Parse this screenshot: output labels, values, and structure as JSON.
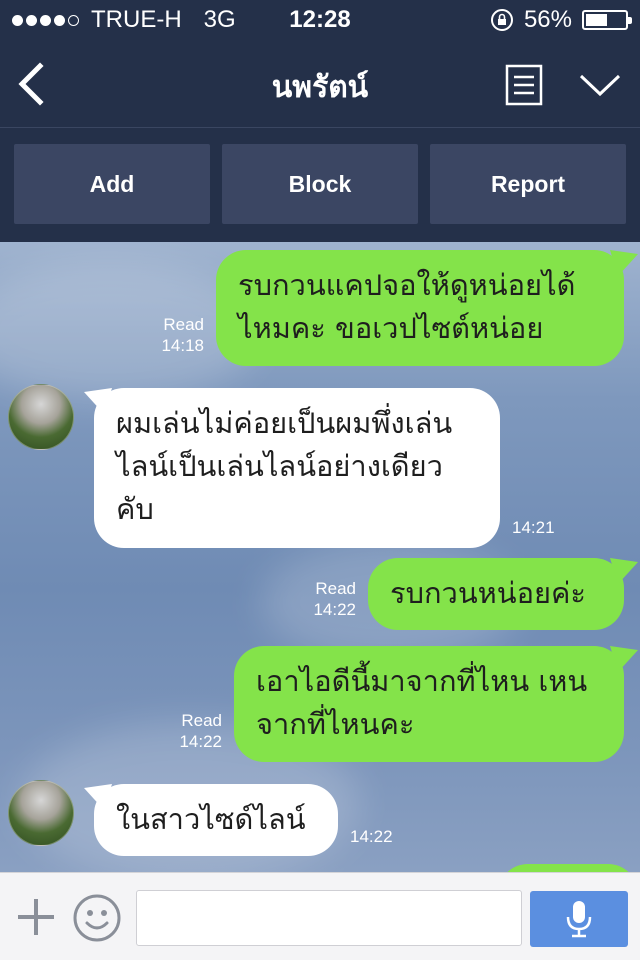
{
  "status": {
    "carrier": "TRUE-H",
    "network": "3G",
    "time": "12:28",
    "battery": "56%",
    "battery_level": 0.56,
    "signal_bars": 4
  },
  "nav": {
    "title": "นพรัตน์",
    "back_icon": "chevron-left-icon",
    "notes_icon": "notes-icon",
    "menu_icon": "chevron-down-icon"
  },
  "actions": {
    "add": "Add",
    "block": "Block",
    "report": "Report"
  },
  "messages": [
    {
      "dir": "out",
      "lines": [
        "รบกวนแคปจอให้ดูหน่อยได้",
        "ไหมคะ ขอเวปไซต์หน่อย"
      ],
      "read": "Read",
      "time": "14:18"
    },
    {
      "dir": "in",
      "lines": [
        "ผมเล่นไม่ค่อยเป็นผมพึ่งเล่น",
        "ไลน์เป็นเล่นไลน์อย่างเดียว",
        "คับ"
      ],
      "time": "14:21"
    },
    {
      "dir": "out",
      "lines": [
        "รบกวนหน่อยค่ะ"
      ],
      "read": "Read",
      "time": "14:22"
    },
    {
      "dir": "out",
      "lines": [
        "เอาไอดีนี้มาจากที่ไหน เหน",
        "จากที่ไหนคะ"
      ],
      "read": "Read",
      "time": "14:22"
    },
    {
      "dir": "in",
      "lines": [
        "ในสาวไซด์ไลน์"
      ],
      "time": "14:22"
    }
  ],
  "input": {
    "placeholder": ""
  },
  "colors": {
    "header": "#243049",
    "button": "#3b4663",
    "outgoing": "#84e34a",
    "incoming": "#ffffff",
    "mic": "#5b8fe0"
  }
}
